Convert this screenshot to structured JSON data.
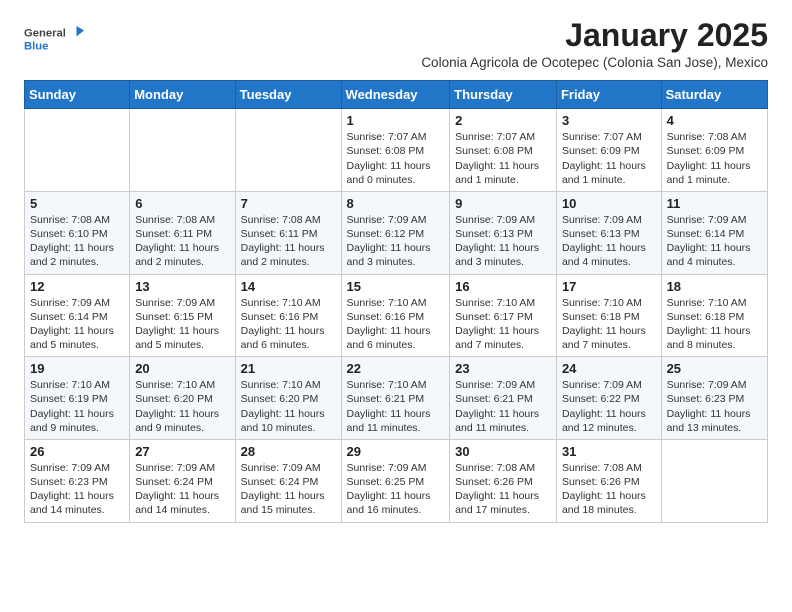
{
  "logo": {
    "general": "General",
    "blue": "Blue"
  },
  "title": "January 2025",
  "subtitle": "Colonia Agricola de Ocotepec (Colonia San Jose), Mexico",
  "days_of_week": [
    "Sunday",
    "Monday",
    "Tuesday",
    "Wednesday",
    "Thursday",
    "Friday",
    "Saturday"
  ],
  "weeks": [
    [
      {
        "day": "",
        "info": ""
      },
      {
        "day": "",
        "info": ""
      },
      {
        "day": "",
        "info": ""
      },
      {
        "day": "1",
        "info": "Sunrise: 7:07 AM\nSunset: 6:08 PM\nDaylight: 11 hours\nand 0 minutes."
      },
      {
        "day": "2",
        "info": "Sunrise: 7:07 AM\nSunset: 6:08 PM\nDaylight: 11 hours\nand 1 minute."
      },
      {
        "day": "3",
        "info": "Sunrise: 7:07 AM\nSunset: 6:09 PM\nDaylight: 11 hours\nand 1 minute."
      },
      {
        "day": "4",
        "info": "Sunrise: 7:08 AM\nSunset: 6:09 PM\nDaylight: 11 hours\nand 1 minute."
      }
    ],
    [
      {
        "day": "5",
        "info": "Sunrise: 7:08 AM\nSunset: 6:10 PM\nDaylight: 11 hours\nand 2 minutes."
      },
      {
        "day": "6",
        "info": "Sunrise: 7:08 AM\nSunset: 6:11 PM\nDaylight: 11 hours\nand 2 minutes."
      },
      {
        "day": "7",
        "info": "Sunrise: 7:08 AM\nSunset: 6:11 PM\nDaylight: 11 hours\nand 2 minutes."
      },
      {
        "day": "8",
        "info": "Sunrise: 7:09 AM\nSunset: 6:12 PM\nDaylight: 11 hours\nand 3 minutes."
      },
      {
        "day": "9",
        "info": "Sunrise: 7:09 AM\nSunset: 6:13 PM\nDaylight: 11 hours\nand 3 minutes."
      },
      {
        "day": "10",
        "info": "Sunrise: 7:09 AM\nSunset: 6:13 PM\nDaylight: 11 hours\nand 4 minutes."
      },
      {
        "day": "11",
        "info": "Sunrise: 7:09 AM\nSunset: 6:14 PM\nDaylight: 11 hours\nand 4 minutes."
      }
    ],
    [
      {
        "day": "12",
        "info": "Sunrise: 7:09 AM\nSunset: 6:14 PM\nDaylight: 11 hours\nand 5 minutes."
      },
      {
        "day": "13",
        "info": "Sunrise: 7:09 AM\nSunset: 6:15 PM\nDaylight: 11 hours\nand 5 minutes."
      },
      {
        "day": "14",
        "info": "Sunrise: 7:10 AM\nSunset: 6:16 PM\nDaylight: 11 hours\nand 6 minutes."
      },
      {
        "day": "15",
        "info": "Sunrise: 7:10 AM\nSunset: 6:16 PM\nDaylight: 11 hours\nand 6 minutes."
      },
      {
        "day": "16",
        "info": "Sunrise: 7:10 AM\nSunset: 6:17 PM\nDaylight: 11 hours\nand 7 minutes."
      },
      {
        "day": "17",
        "info": "Sunrise: 7:10 AM\nSunset: 6:18 PM\nDaylight: 11 hours\nand 7 minutes."
      },
      {
        "day": "18",
        "info": "Sunrise: 7:10 AM\nSunset: 6:18 PM\nDaylight: 11 hours\nand 8 minutes."
      }
    ],
    [
      {
        "day": "19",
        "info": "Sunrise: 7:10 AM\nSunset: 6:19 PM\nDaylight: 11 hours\nand 9 minutes."
      },
      {
        "day": "20",
        "info": "Sunrise: 7:10 AM\nSunset: 6:20 PM\nDaylight: 11 hours\nand 9 minutes."
      },
      {
        "day": "21",
        "info": "Sunrise: 7:10 AM\nSunset: 6:20 PM\nDaylight: 11 hours\nand 10 minutes."
      },
      {
        "day": "22",
        "info": "Sunrise: 7:10 AM\nSunset: 6:21 PM\nDaylight: 11 hours\nand 11 minutes."
      },
      {
        "day": "23",
        "info": "Sunrise: 7:09 AM\nSunset: 6:21 PM\nDaylight: 11 hours\nand 11 minutes."
      },
      {
        "day": "24",
        "info": "Sunrise: 7:09 AM\nSunset: 6:22 PM\nDaylight: 11 hours\nand 12 minutes."
      },
      {
        "day": "25",
        "info": "Sunrise: 7:09 AM\nSunset: 6:23 PM\nDaylight: 11 hours\nand 13 minutes."
      }
    ],
    [
      {
        "day": "26",
        "info": "Sunrise: 7:09 AM\nSunset: 6:23 PM\nDaylight: 11 hours\nand 14 minutes."
      },
      {
        "day": "27",
        "info": "Sunrise: 7:09 AM\nSunset: 6:24 PM\nDaylight: 11 hours\nand 14 minutes."
      },
      {
        "day": "28",
        "info": "Sunrise: 7:09 AM\nSunset: 6:24 PM\nDaylight: 11 hours\nand 15 minutes."
      },
      {
        "day": "29",
        "info": "Sunrise: 7:09 AM\nSunset: 6:25 PM\nDaylight: 11 hours\nand 16 minutes."
      },
      {
        "day": "30",
        "info": "Sunrise: 7:08 AM\nSunset: 6:26 PM\nDaylight: 11 hours\nand 17 minutes."
      },
      {
        "day": "31",
        "info": "Sunrise: 7:08 AM\nSunset: 6:26 PM\nDaylight: 11 hours\nand 18 minutes."
      },
      {
        "day": "",
        "info": ""
      }
    ]
  ]
}
